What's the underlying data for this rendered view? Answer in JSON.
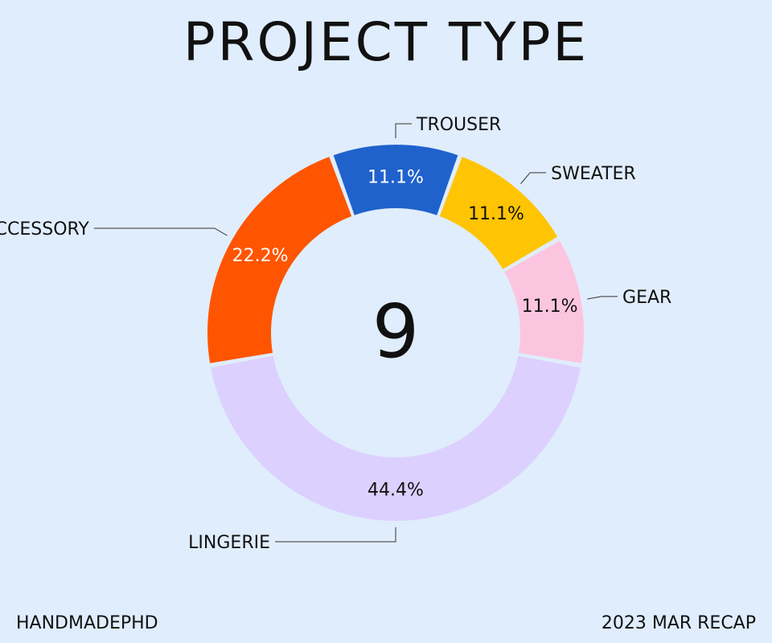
{
  "title": "PROJECT TYPE",
  "footer": {
    "left": "HANDMADEPHD",
    "right": "2023 MAR RECAP"
  },
  "chart_data": {
    "type": "pie",
    "variant": "donut",
    "center_label": "9",
    "categories": [
      "GEAR",
      "SWEATER",
      "TROUSER",
      "ACCESSORY",
      "LINGERIE"
    ],
    "values": [
      1,
      1,
      1,
      2,
      4
    ],
    "percent_labels": [
      "11.1%",
      "11.1%",
      "11.1%",
      "22.2%",
      "44.4%"
    ],
    "colors": [
      "#fcc5df",
      "#ffc403",
      "#1f62cc",
      "#ff5500",
      "#dcd0fe"
    ],
    "label_text_colors": [
      "#111111",
      "#111111",
      "#ffffff",
      "#ffffff",
      "#111111"
    ]
  }
}
